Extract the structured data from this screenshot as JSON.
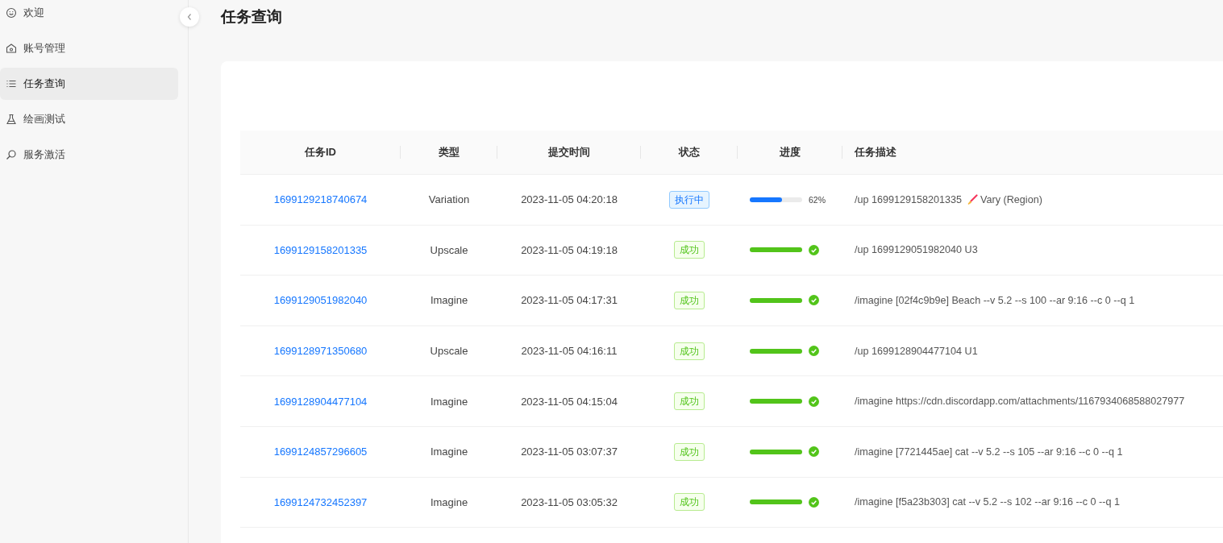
{
  "sidebar": {
    "items": [
      {
        "label": "欢迎",
        "selected": false
      },
      {
        "label": "账号管理",
        "selected": false
      },
      {
        "label": "任务查询",
        "selected": true
      },
      {
        "label": "绘画测试",
        "selected": false
      },
      {
        "label": "服务激活",
        "selected": false
      }
    ]
  },
  "page": {
    "title": "任务查询"
  },
  "table": {
    "columns": [
      "任务ID",
      "类型",
      "提交时间",
      "状态",
      "进度",
      "任务描述"
    ],
    "rows": [
      {
        "id": "1699129218740674",
        "type": "Variation",
        "time": "2023-11-05 04:20:18",
        "status": {
          "kind": "processing",
          "text": "执行中"
        },
        "progress": {
          "level": 0.62,
          "reading": "62%"
        },
        "description": {
          "text": "/up 1699129158201335",
          "suffix": "Vary (Region)"
        }
      },
      {
        "id": "1699129158201335",
        "type": "Upscale",
        "time": "2023-11-05 04:19:18",
        "status": {
          "kind": "success",
          "text": "成功"
        },
        "progress": {
          "level": 1
        },
        "description": {
          "text": "/up 1699129051982040 U3"
        }
      },
      {
        "id": "1699129051982040",
        "type": "Imagine",
        "time": "2023-11-05 04:17:31",
        "status": {
          "kind": "success",
          "text": "成功"
        },
        "progress": {
          "level": 1
        },
        "description": {
          "text": "/imagine [02f4c9b9e] Beach --v 5.2 --s 100 --ar 9:16 --c 0 --q 1"
        }
      },
      {
        "id": "1699128971350680",
        "type": "Upscale",
        "time": "2023-11-05 04:16:11",
        "status": {
          "kind": "success",
          "text": "成功"
        },
        "progress": {
          "level": 1
        },
        "description": {
          "text": "/up 1699128904477104 U1"
        }
      },
      {
        "id": "1699128904477104",
        "type": "Imagine",
        "time": "2023-11-05 04:15:04",
        "status": {
          "kind": "success",
          "text": "成功"
        },
        "progress": {
          "level": 1
        },
        "description": {
          "text": "/imagine https://cdn.discordapp.com/attachments/1167934068588027977"
        }
      },
      {
        "id": "1699124857296605",
        "type": "Imagine",
        "time": "2023-11-05 03:07:37",
        "status": {
          "kind": "success",
          "text": "成功"
        },
        "progress": {
          "level": 1
        },
        "description": {
          "text": "/imagine [7721445ae] cat --v 5.2 --s 105 --ar 9:16 --c 0 --q 1"
        }
      },
      {
        "id": "1699124732452397",
        "type": "Imagine",
        "time": "2023-11-05 03:05:32",
        "status": {
          "kind": "success",
          "text": "成功"
        },
        "progress": {
          "level": 1
        },
        "description": {
          "text": "/imagine [f5a23b303] cat --v 5.2 --s 102 --ar 9:16 --c 0 --q 1"
        }
      }
    ]
  }
}
